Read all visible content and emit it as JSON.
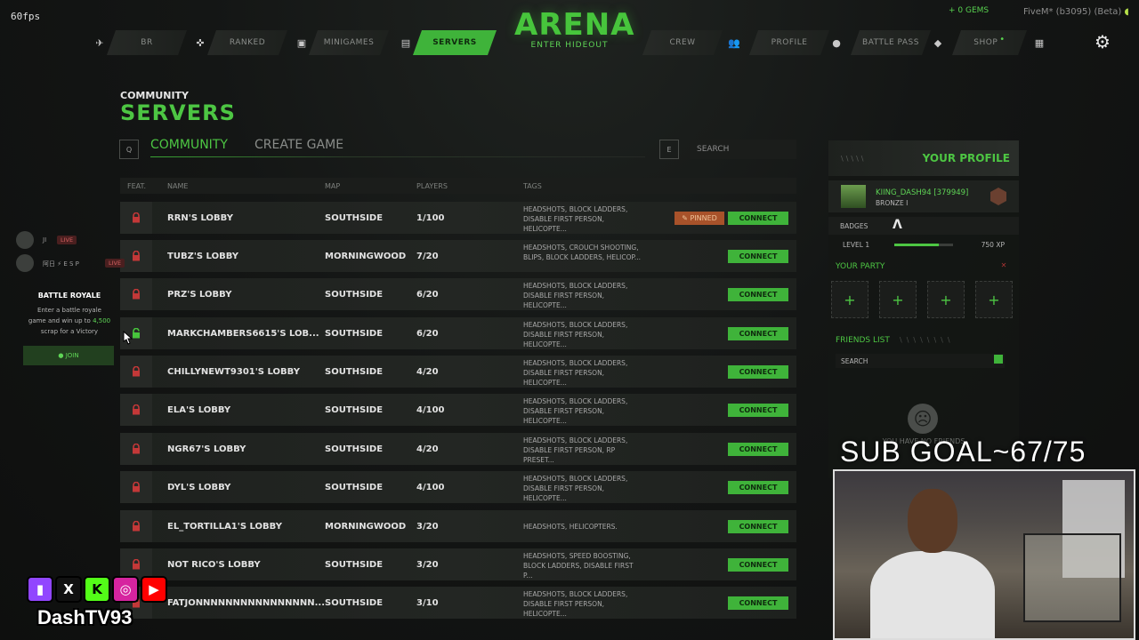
{
  "overlay": {
    "fps": "60fps",
    "sub_goal": "SUB GOAL~67/75",
    "channel": "DashTV93"
  },
  "nav": {
    "items": [
      {
        "label": "BR"
      },
      {
        "label": "RANKED"
      },
      {
        "label": "MINIGAMES"
      },
      {
        "label": "SERVERS",
        "active": true
      },
      {
        "label": "CREW"
      },
      {
        "label": "PROFILE"
      },
      {
        "label": "BATTLE PASS"
      },
      {
        "label": "SHOP"
      }
    ],
    "logo_title": "ARENA",
    "logo_sub": "ENTER HIDEOUT",
    "gems": "+ 0 GEMS",
    "user_tag": "FiveM* (b3095) (Beta)"
  },
  "page": {
    "kicker": "COMMUNITY",
    "title": "SERVERS",
    "key_left": "Q",
    "key_right": "E",
    "tabs": [
      {
        "label": "COMMUNITY",
        "active": true
      },
      {
        "label": "CREATE GAME"
      }
    ],
    "search_placeholder": "SEARCH"
  },
  "table": {
    "headers": {
      "feat": "FEAT.",
      "name": "NAME",
      "map": "MAP",
      "players": "PLAYERS",
      "tags": "TAGS"
    },
    "pinned_label": "PINNED",
    "connect_label": "CONNECT",
    "rows": [
      {
        "locked": true,
        "name": "RRN'S LOBBY",
        "map": "SOUTHSIDE",
        "players": "1/100",
        "tags": "HEADSHOTS, BLOCK LADDERS, DISABLE FIRST PERSON, HELICOPTE...",
        "pinned": true
      },
      {
        "locked": true,
        "name": "TUBZ'S LOBBY",
        "map": "MORNINGWOOD",
        "players": "7/20",
        "tags": "HEADSHOTS, CROUCH SHOOTING, BLIPS, BLOCK LADDERS, HELICOP..."
      },
      {
        "locked": true,
        "name": "PRZ'S LOBBY",
        "map": "SOUTHSIDE",
        "players": "6/20",
        "tags": "HEADSHOTS, BLOCK LADDERS, DISABLE FIRST PERSON, HELICOPTE..."
      },
      {
        "locked": false,
        "name": "MARKCHAMBERS6615'S LOB...",
        "map": "SOUTHSIDE",
        "players": "6/20",
        "tags": "HEADSHOTS, BLOCK LADDERS, DISABLE FIRST PERSON, HELICOPTE..."
      },
      {
        "locked": true,
        "name": "CHILLYNEWT9301'S LOBBY",
        "map": "SOUTHSIDE",
        "players": "4/20",
        "tags": "HEADSHOTS, BLOCK LADDERS, DISABLE FIRST PERSON, HELICOPTE..."
      },
      {
        "locked": true,
        "name": "ELA'S LOBBY",
        "map": "SOUTHSIDE",
        "players": "4/100",
        "tags": "HEADSHOTS, BLOCK LADDERS, DISABLE FIRST PERSON, HELICOPTE..."
      },
      {
        "locked": true,
        "name": "NGR67'S LOBBY",
        "map": "SOUTHSIDE",
        "players": "4/20",
        "tags": "HEADSHOTS, BLOCK LADDERS, DISABLE FIRST PERSON, RP PRESET..."
      },
      {
        "locked": true,
        "name": "DYL'S LOBBY",
        "map": "SOUTHSIDE",
        "players": "4/100",
        "tags": "HEADSHOTS, BLOCK LADDERS, DISABLE FIRST PERSON, HELICOPTE..."
      },
      {
        "locked": true,
        "name": "EL_TORTILLA1'S LOBBY",
        "map": "MORNINGWOOD",
        "players": "3/20",
        "tags": "HEADSHOTS, HELICOPTERS."
      },
      {
        "locked": true,
        "name": "NOT RICO'S LOBBY",
        "map": "SOUTHSIDE",
        "players": "3/20",
        "tags": "HEADSHOTS, SPEED BOOSTING, BLOCK LADDERS, DISABLE FIRST P..."
      },
      {
        "locked": true,
        "name": "FATJONNNNNNNNNNNNNNNN...",
        "map": "SOUTHSIDE",
        "players": "3/10",
        "tags": "HEADSHOTS, BLOCK LADDERS, DISABLE FIRST PERSON, HELICOPTE..."
      }
    ]
  },
  "left_overlay": {
    "live": [
      {
        "name": "JI",
        "badge": "LIVE"
      },
      {
        "name": "阿日 ⚡ E S P",
        "badge": "LIVE"
      }
    ],
    "br_title": "BATTLE ROYALE",
    "br_desc_a": "Enter a battle royale",
    "br_desc_b": "game and win up to",
    "br_desc_hl": "4,500",
    "br_desc_c": "scrap for a Victory",
    "join": "JOIN"
  },
  "profile": {
    "title": "YOUR PROFILE",
    "name": "KIING_DASH94 [379949]",
    "rank": "BRONZE I",
    "badges_label": "BADGES",
    "level": "LEVEL 1",
    "xp": "750 XP",
    "xp_fraction": 0.75,
    "party_title": "YOUR PARTY",
    "friends_title": "FRIENDS LIST",
    "friends_search": "SEARCH",
    "no_friends": "YOU HAVE NO FRIENDS"
  },
  "colors": {
    "accent": "#3fb33a",
    "lock_red": "#c33838",
    "pinned": "#a8522a"
  },
  "icons": {
    "lock_closed": "lock-icon",
    "lock_open": "unlock-icon",
    "settings": "gear-icon"
  }
}
